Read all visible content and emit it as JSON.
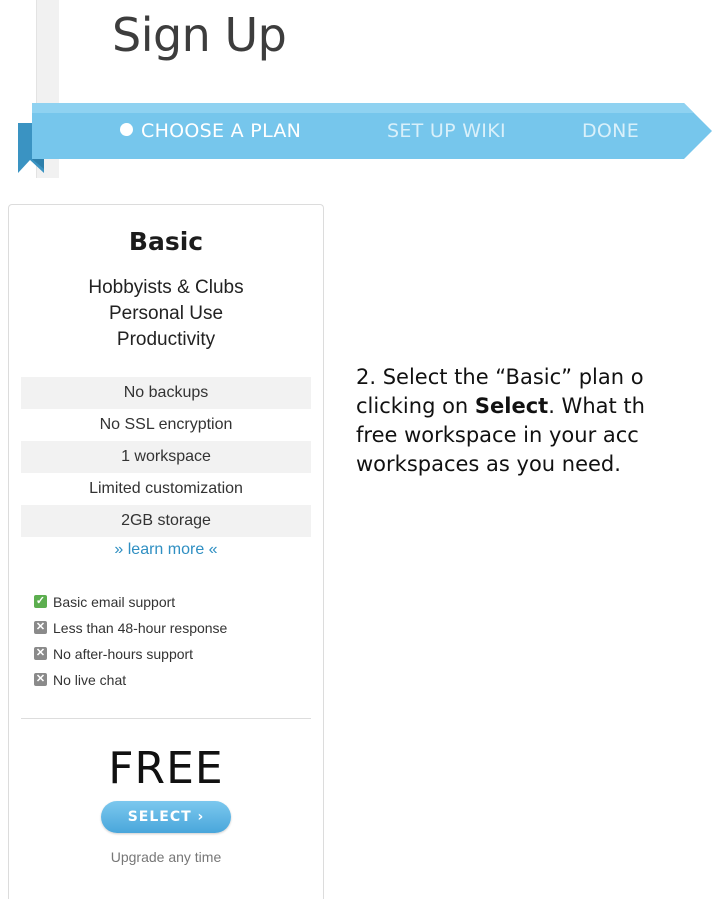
{
  "page_title": "Sign Up",
  "steps": {
    "choose": "CHOOSE  A PLAN",
    "setup": "SET UP WIKI",
    "done": "DONE"
  },
  "plan": {
    "name": "Basic",
    "taglines": [
      "Hobbyists & Clubs",
      "Personal Use",
      "Productivity"
    ],
    "features": [
      "No backups",
      "No SSL encryption",
      "1 workspace",
      "Limited customization",
      "2GB storage"
    ],
    "learn_more": "» learn more «",
    "support": [
      {
        "label": "Basic email support",
        "included": true
      },
      {
        "label": "Less than 48-hour response",
        "included": false
      },
      {
        "label": "No after-hours support",
        "included": false
      },
      {
        "label": "No live chat",
        "included": false
      }
    ],
    "price": "FREE",
    "select_label": "SELECT  ›",
    "upgrade_note": "Upgrade any time"
  },
  "instructions": {
    "line1": "2. Select the “Basic” plan o",
    "line2_pre": "clicking on ",
    "line2_bold": "Select",
    "line2_post": ". What th",
    "line3": "free workspace in your acc",
    "line4": "workspaces as you need."
  },
  "colors": {
    "ribbon": "#6ec3ea",
    "accent": "#49a6db",
    "check": "#5cae4f"
  }
}
